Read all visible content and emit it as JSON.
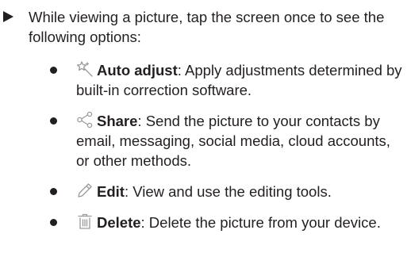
{
  "intro": {
    "text": "While viewing a picture, tap the screen once to see the following options:"
  },
  "options": [
    {
      "icon": "auto-adjust-icon",
      "term": "Auto adjust",
      "description": ": Apply adjustments determined by built-in correction software."
    },
    {
      "icon": "share-icon",
      "term": "Share",
      "description": ": Send the picture to your contacts by email, messaging, social media, cloud accounts, or other methods."
    },
    {
      "icon": "edit-icon",
      "term": "Edit",
      "description": ": View and use the editing tools."
    },
    {
      "icon": "delete-icon",
      "term": "Delete",
      "description": ": Delete the picture from your device."
    }
  ],
  "colors": {
    "text": "#231f20",
    "icon": "#9a9a9a"
  }
}
